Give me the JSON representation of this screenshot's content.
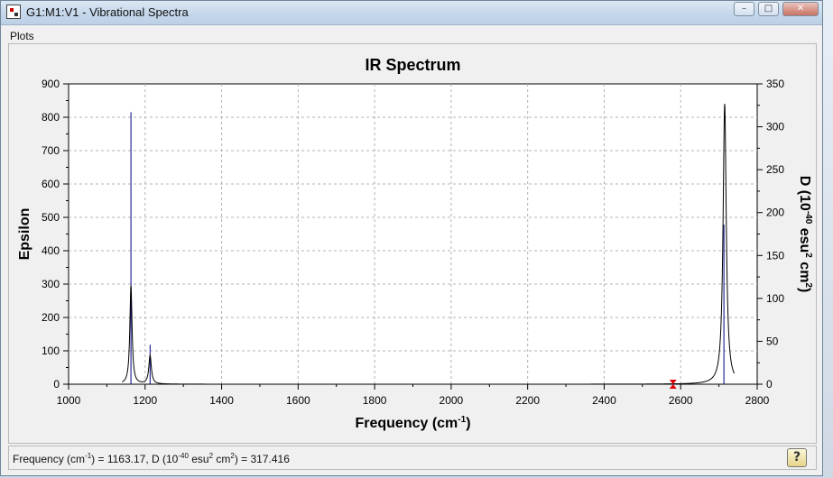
{
  "window": {
    "title": "G1:M1:V1 - Vibrational Spectra",
    "minimize_glyph": "–",
    "maximize_glyph": "□",
    "close_glyph": "✕"
  },
  "menu": {
    "items": [
      "Plots"
    ]
  },
  "status": {
    "label_freq": "Frequency (cm",
    "sup_freq": "-1",
    "eq_part": ") = 1163.17, D (10",
    "sup_d": "-40",
    "unit_part": " esu",
    "sup_esu": "2",
    "cm_part": " cm",
    "sup_cm": "2",
    "value_part": ") = 317.416",
    "help_glyph": "?",
    "help_icon": "help-icon"
  },
  "colors": {
    "curve": "#000000",
    "stick": "#00007f",
    "marker": "#e00000",
    "grid": "#b3b3b3",
    "plot_bg": "#ffffff"
  },
  "chart_data": {
    "type": "line",
    "title": "IR Spectrum",
    "xlabel_main": "Frequency (cm",
    "xlabel_sup": "-1",
    "xlabel_end": ")",
    "ylabel_left": "Epsilon",
    "ylabel_right_parts": [
      "D (10",
      "-40",
      " esu",
      "2",
      " cm",
      "2",
      ")"
    ],
    "xlim": [
      1000,
      2800
    ],
    "ylim_left": [
      0,
      900
    ],
    "ylim_right": [
      0,
      350
    ],
    "x_ticks": [
      1000,
      1200,
      1400,
      1600,
      1800,
      2000,
      2200,
      2400,
      2600,
      2800
    ],
    "y_ticks_left": [
      0,
      100,
      200,
      300,
      400,
      500,
      600,
      700,
      800,
      900
    ],
    "y_ticks_right": [
      0,
      50,
      100,
      150,
      200,
      250,
      300,
      350
    ],
    "grid": true,
    "curve_peaks": [
      {
        "x": 1163,
        "height": 295,
        "width": 3.5
      },
      {
        "x": 1213,
        "height": 85,
        "width": 4
      },
      {
        "x": 2715,
        "height": 840,
        "width": 5
      }
    ],
    "curve_range": [
      1140,
      2740
    ],
    "sticks": [
      {
        "x": 1163,
        "d": 317
      },
      {
        "x": 1213,
        "d": 46
      },
      {
        "x": 2713,
        "d": 186
      }
    ],
    "marker_x": 2580
  }
}
